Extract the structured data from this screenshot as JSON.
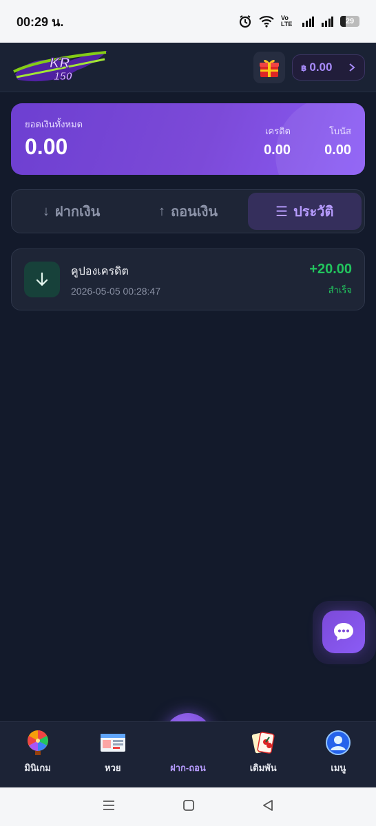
{
  "status_bar": {
    "time": "00:29 น.",
    "battery": "29",
    "network_label": "Vo LTE"
  },
  "header": {
    "logo_text": "KR 150",
    "balance_currency": "฿",
    "balance": "0.00"
  },
  "summary": {
    "total_label": "ยอดเงินทั้งหมด",
    "total_value": "0.00",
    "credit_label": "เครดิต",
    "credit_value": "0.00",
    "bonus_label": "โบนัส",
    "bonus_value": "0.00"
  },
  "tabs": [
    {
      "label": "ฝากเงิน",
      "arrow": "↓",
      "active": false
    },
    {
      "label": "ถอนเงิน",
      "arrow": "↑",
      "active": false
    },
    {
      "label": "ประวัติ",
      "arrow": "☰",
      "active": true
    }
  ],
  "transactions": [
    {
      "title": "คูปองเครดิต",
      "datetime": "2026-05-05 00:28:47",
      "amount": "+20.00",
      "status": "สำเร็จ",
      "icon": "arrow-down-icon"
    }
  ],
  "bottom_nav": [
    {
      "label": "มินิเกม",
      "icon": "wheel-icon"
    },
    {
      "label": "หวย",
      "icon": "lottery-ticket-icon"
    },
    {
      "label": "ฝาก-ถอน",
      "icon": "wallet-icon",
      "active": true
    },
    {
      "label": "เดิมพัน",
      "icon": "cards-icon"
    },
    {
      "label": "เมนู",
      "icon": "user-icon"
    }
  ],
  "colors": {
    "accent": "#8b5cf6",
    "success": "#22c55e",
    "background": "#131a2b"
  }
}
